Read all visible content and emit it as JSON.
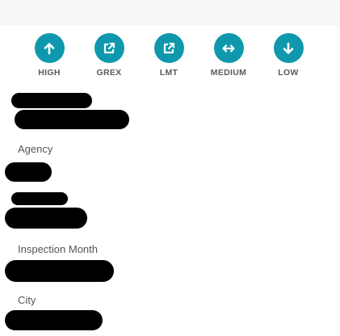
{
  "actions": [
    {
      "label": "HIGH",
      "icon": "arrow-up-icon"
    },
    {
      "label": "GREX",
      "icon": "external-link-icon"
    },
    {
      "label": "LMT",
      "icon": "external-link-icon"
    },
    {
      "label": "MEDIUM",
      "icon": "arrows-horizontal-icon"
    },
    {
      "label": "LOW",
      "icon": "arrow-down-icon"
    }
  ],
  "fields": {
    "agency_label": "Agency",
    "inspection_month_label": "Inspection Month",
    "city_label": "City"
  },
  "colors": {
    "accent": "#0f98ad",
    "label_text": "#555555",
    "redaction": "#000000"
  }
}
